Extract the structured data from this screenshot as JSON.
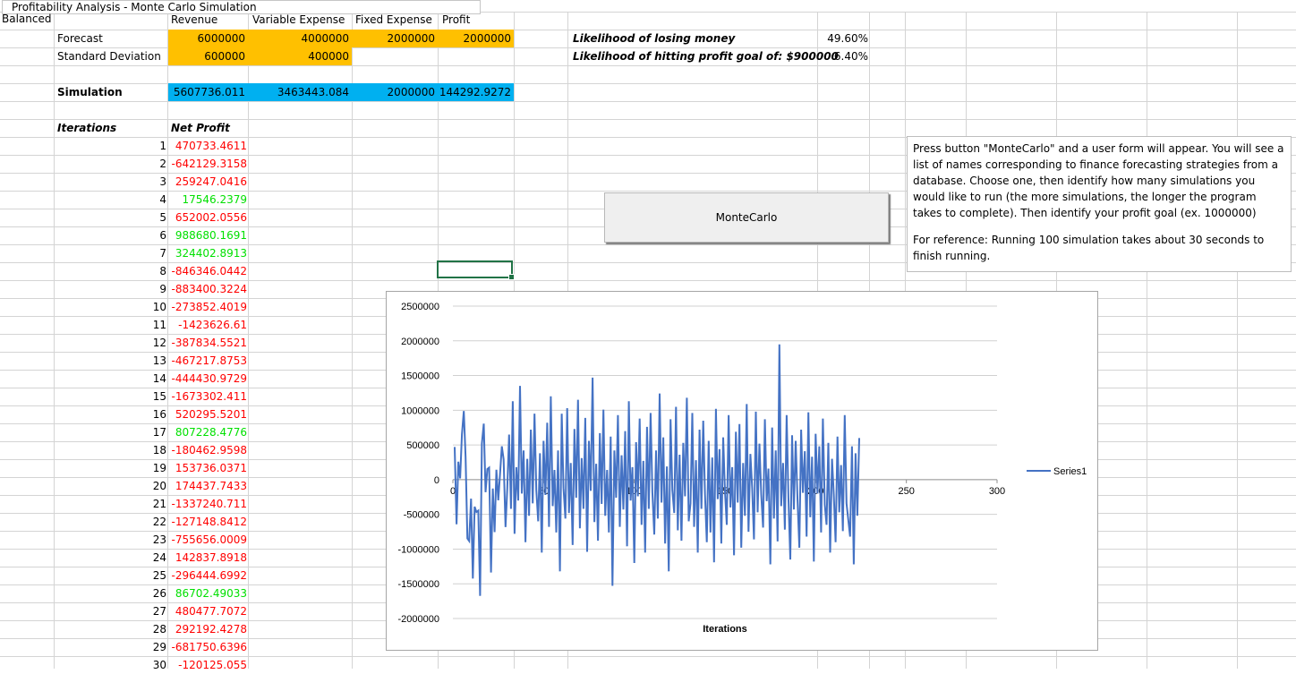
{
  "title": "Profitability Analysis - Monte Carlo Simulation",
  "header": {
    "a1": "Balanced",
    "cols": [
      "Revenue",
      "Variable Expense",
      "Fixed Expense",
      "Profit"
    ]
  },
  "forecast": {
    "label": "Forecast",
    "revenue": "6000000",
    "variable": "4000000",
    "fixed": "2000000",
    "profit": "2000000"
  },
  "stddev": {
    "label": "Standard Deviation",
    "revenue": "600000",
    "variable": "400000"
  },
  "likelihood": {
    "lose_label": "Likelihood of losing money",
    "lose_value": "49.60%",
    "goal_label": "Likelihood of hitting profit goal of: $900000",
    "goal_value": "6.40%"
  },
  "simulation": {
    "label": "Simulation",
    "revenue": "5607736.011",
    "variable": "3463443.084",
    "fixed": "2000000",
    "profit": "144292.9272"
  },
  "iterations": {
    "label": "Iterations",
    "netprofit_label": "Net Profit",
    "rows": [
      {
        "n": "1",
        "v": "470733.4611",
        "c": "red"
      },
      {
        "n": "2",
        "v": "-642129.3158",
        "c": "red"
      },
      {
        "n": "3",
        "v": "259247.0416",
        "c": "red"
      },
      {
        "n": "4",
        "v": "17546.2379",
        "c": "green"
      },
      {
        "n": "5",
        "v": "652002.0556",
        "c": "red"
      },
      {
        "n": "6",
        "v": "988680.1691",
        "c": "green"
      },
      {
        "n": "7",
        "v": "324402.8913",
        "c": "green"
      },
      {
        "n": "8",
        "v": "-846346.0442",
        "c": "red"
      },
      {
        "n": "9",
        "v": "-883400.3224",
        "c": "red"
      },
      {
        "n": "10",
        "v": "-273852.4019",
        "c": "red"
      },
      {
        "n": "11",
        "v": "-1423626.61",
        "c": "red"
      },
      {
        "n": "12",
        "v": "-387834.5521",
        "c": "red"
      },
      {
        "n": "13",
        "v": "-467217.8753",
        "c": "red"
      },
      {
        "n": "14",
        "v": "-444430.9729",
        "c": "red"
      },
      {
        "n": "15",
        "v": "-1673302.411",
        "c": "red"
      },
      {
        "n": "16",
        "v": "520295.5201",
        "c": "red"
      },
      {
        "n": "17",
        "v": "807228.4776",
        "c": "green"
      },
      {
        "n": "18",
        "v": "-180462.9598",
        "c": "red"
      },
      {
        "n": "19",
        "v": "153736.0371",
        "c": "red"
      },
      {
        "n": "20",
        "v": "174437.7433",
        "c": "red"
      },
      {
        "n": "21",
        "v": "-1337240.711",
        "c": "red"
      },
      {
        "n": "22",
        "v": "-127148.8412",
        "c": "red"
      },
      {
        "n": "23",
        "v": "-755656.0009",
        "c": "red"
      },
      {
        "n": "24",
        "v": "142837.8918",
        "c": "red"
      },
      {
        "n": "25",
        "v": "-296444.6992",
        "c": "red"
      },
      {
        "n": "26",
        "v": "86702.49033",
        "c": "green"
      },
      {
        "n": "27",
        "v": "480477.7072",
        "c": "red"
      },
      {
        "n": "28",
        "v": "292192.4278",
        "c": "red"
      },
      {
        "n": "29",
        "v": "-681750.6396",
        "c": "red"
      },
      {
        "n": "30",
        "v": "-120125.055",
        "c": "red"
      }
    ]
  },
  "button": {
    "label": "MonteCarlo"
  },
  "note": {
    "p1": "Press button \"MonteCarlo\" and a user form will appear. You will see a list of names corresponding to finance forecasting strategies from a database. Choose one, then identify how many simulations you would like to run (the more simulations, the longer the program takes to complete). Then identify your profit goal (ex. 1000000)",
    "p2": "For reference: Running 100 simulation takes about 30 seconds to finish running."
  },
  "colors": {
    "yellow": "#FFC000",
    "blue": "#00B0F0",
    "series": "#4472C4",
    "red": "#FF0000",
    "green": "#00E000"
  },
  "chart_data": {
    "type": "line",
    "xlabel": "Iterations",
    "ylabel": "",
    "legend": "right",
    "ylim": [
      -2000000,
      2500000
    ],
    "xlim": [
      0,
      300
    ],
    "yticks": [
      "2500000",
      "2000000",
      "1500000",
      "1000000",
      "500000",
      "0",
      "-500000",
      "-1000000",
      "-1500000",
      "-2000000"
    ],
    "xticks": [
      "0",
      "50",
      "100",
      "150",
      "200",
      "250",
      "300"
    ],
    "series": [
      {
        "name": "Series1",
        "values": [
          470733,
          -642129,
          259247,
          17546,
          652002,
          988680,
          324403,
          -846346,
          -883400,
          -273852,
          -1423627,
          -387835,
          -467218,
          -444431,
          -1673302,
          520296,
          807228,
          -180463,
          153736,
          174438,
          -1337241,
          -127149,
          -755656,
          142838,
          -296445,
          86702,
          480478,
          292192,
          -681751,
          -120125,
          650000,
          -420000,
          1130000,
          -780000,
          180000,
          -300000,
          1350000,
          -200000,
          420000,
          -900000,
          300000,
          -520000,
          720000,
          -340000,
          950000,
          -150000,
          -600000,
          380000,
          -1050000,
          560000,
          -220000,
          820000,
          -680000,
          1200000,
          -380000,
          140000,
          -760000,
          420000,
          -1320000,
          950000,
          -120000,
          -560000,
          1030000,
          -480000,
          240000,
          -940000,
          730000,
          -260000,
          1150000,
          -700000,
          310000,
          -420000,
          890000,
          -1040000,
          560000,
          -160000,
          1470000,
          -610000,
          230000,
          -880000,
          670000,
          -350000,
          1010000,
          -520000,
          140000,
          -760000,
          620000,
          -1530000,
          420000,
          -260000,
          930000,
          -680000,
          350000,
          -430000,
          700000,
          -960000,
          1130000,
          -300000,
          180000,
          -1200000,
          540000,
          -240000,
          880000,
          -650000,
          270000,
          -1050000,
          760000,
          -420000,
          960000,
          -180000,
          -790000,
          420000,
          -560000,
          1240000,
          -330000,
          610000,
          -920000,
          190000,
          -1320000,
          870000,
          -150000,
          -480000,
          1050000,
          -730000,
          360000,
          -880000,
          530000,
          -240000,
          1180000,
          -600000,
          -340000,
          960000,
          -680000,
          280000,
          -1050000,
          720000,
          -420000,
          850000,
          -220000,
          -900000,
          560000,
          -760000,
          320000,
          -1190000,
          1020000,
          -280000,
          440000,
          -920000,
          610000,
          -170000,
          -650000,
          930000,
          -400000,
          180000,
          -1090000,
          690000,
          -330000,
          800000,
          -980000,
          240000,
          -520000,
          1090000,
          -750000,
          370000,
          -120000,
          -860000,
          980000,
          -470000,
          520000,
          -210000,
          -690000,
          870000,
          -310000,
          160000,
          -1220000,
          750000,
          -560000,
          420000,
          -890000,
          1950000,
          -380000,
          240000,
          -720000,
          930000,
          -250000,
          -1150000,
          640000,
          -430000,
          560000,
          -300000,
          -980000,
          720000,
          -190000,
          410000,
          -820000,
          970000,
          -540000,
          330000,
          -1180000,
          660000,
          -200000,
          480000,
          -760000,
          880000,
          -360000,
          -650000,
          530000,
          -1050000,
          300000,
          -220000,
          -900000,
          620000,
          -470000,
          210000,
          -740000,
          930000,
          -340000,
          -580000,
          -820000,
          480000,
          -1220000,
          380000,
          -520000,
          600000
        ]
      }
    ]
  }
}
